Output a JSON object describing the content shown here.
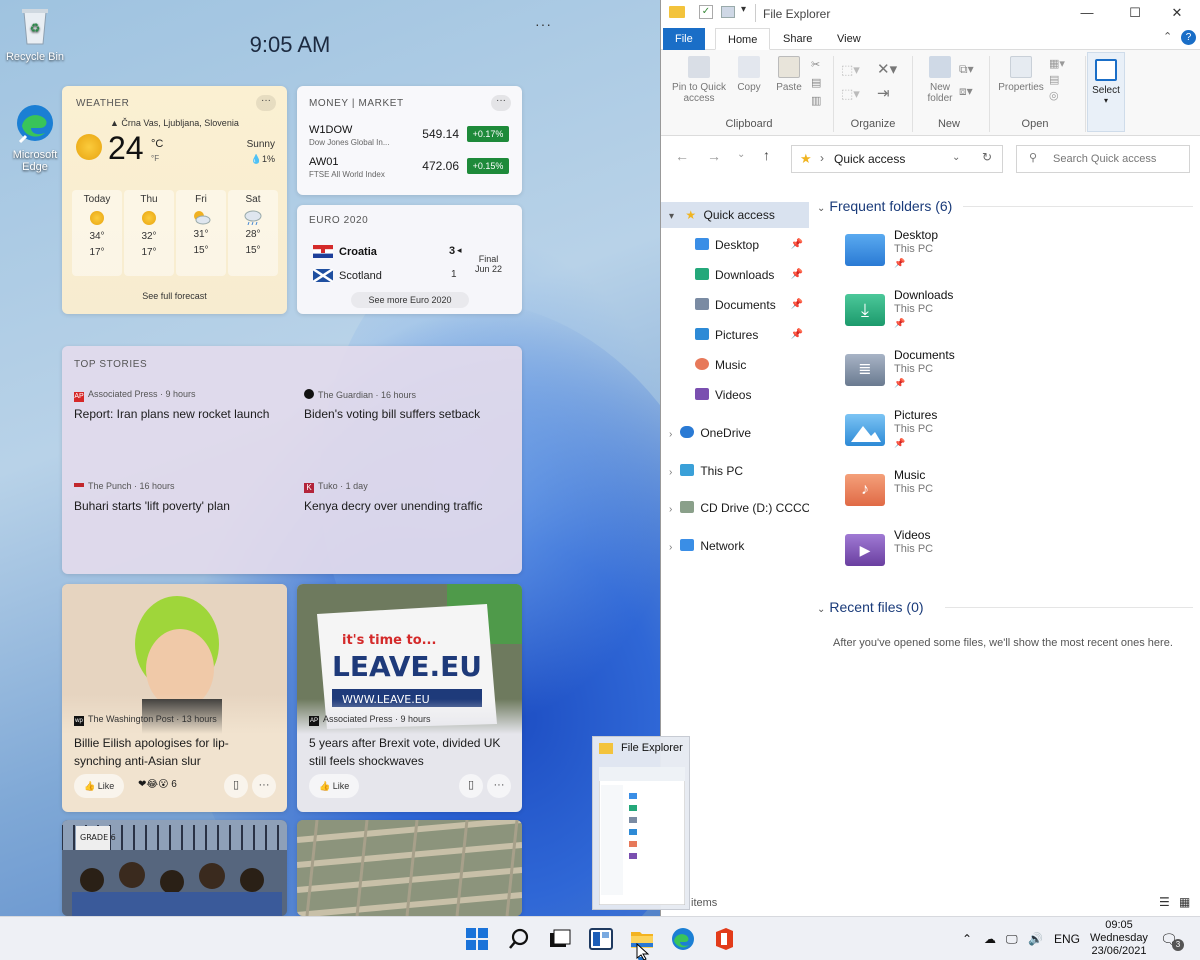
{
  "desktop": {
    "recycle_bin": "Recycle Bin",
    "edge_line1": "Microsoft",
    "edge_line2": "Edge"
  },
  "widgets": {
    "time": "9:05 AM",
    "more_glyph": "···",
    "weather": {
      "header": "WEATHER",
      "location": "Črna Vas, Ljubljana, Slovenia",
      "temp": "24",
      "unit_c": "°C",
      "unit_f": "°F",
      "condition": "Sunny",
      "precip": "1%",
      "days": [
        {
          "name": "Today",
          "high": "34°",
          "low": "17°",
          "icon": "sunny-icon"
        },
        {
          "name": "Thu",
          "high": "32°",
          "low": "17°",
          "icon": "sunny-icon"
        },
        {
          "name": "Fri",
          "high": "31°",
          "low": "15°",
          "icon": "partly-cloudy-icon"
        },
        {
          "name": "Sat",
          "high": "28°",
          "low": "15°",
          "icon": "rain-icon"
        }
      ],
      "forecast_link": "See full forecast"
    },
    "money": {
      "header": "MONEY | MARKET",
      "rows": [
        {
          "symbol": "W1DOW",
          "name": "Dow Jones Global In...",
          "value": "549.14",
          "change": "+0.17%"
        },
        {
          "symbol": "AW01",
          "name": "FTSE All World Index",
          "value": "472.06",
          "change": "+0.15%"
        }
      ]
    },
    "euro": {
      "header": "EURO 2020",
      "team1": "Croatia",
      "score1": "3",
      "team2": "Scotland",
      "score2": "1",
      "status": "Final",
      "date": "Jun 22",
      "more_link": "See more Euro 2020"
    },
    "top_stories": {
      "header": "TOP STORIES",
      "items": [
        {
          "source": "Associated Press · 9 hours",
          "title": "Report: Iran plans new rocket launch"
        },
        {
          "source": "The Guardian · 16 hours",
          "title": "Biden's voting bill suffers setback"
        },
        {
          "source": "The Punch · 16 hours",
          "title": "Buhari starts 'lift poverty' plan"
        },
        {
          "source": "Tuko · 1 day",
          "title": "Kenya decry over unending traffic"
        }
      ]
    },
    "news": [
      {
        "source": "The Washington Post · 13 hours",
        "title": "Billie Eilish apologises for lip-synching anti-Asian slur",
        "like": "Like",
        "reactions": "6"
      },
      {
        "source": "Associated Press · 9 hours",
        "title": "5 years after Brexit vote, divided UK still feels shockwaves",
        "like": "Like",
        "reactions": ""
      }
    ],
    "news_img_text": {
      "sign_top": "it's time to...",
      "sign_main": "LEAVE.EU",
      "sign_url": "WWW.LEAVE.EU",
      "sign2": "GRADE 6"
    }
  },
  "explorer": {
    "title": "File Explorer",
    "menu": {
      "file": "File",
      "home": "Home",
      "share": "Share",
      "view": "View"
    },
    "ribbon": {
      "pin": "Pin to Quick access",
      "copy": "Copy",
      "paste": "Paste",
      "clipboard": "Clipboard",
      "organize": "Organize",
      "new_folder": "New folder",
      "new": "New",
      "properties": "Properties",
      "open": "Open",
      "select": "Select"
    },
    "address": "Quick access",
    "search_placeholder": "Search Quick access",
    "nav": {
      "quick_access": "Quick access",
      "items": [
        "Desktop",
        "Downloads",
        "Documents",
        "Pictures",
        "Music",
        "Videos"
      ],
      "onedrive": "OneDrive",
      "this_pc": "This PC",
      "cd_drive": "CD Drive (D:) CCCOMA",
      "network": "Network"
    },
    "frequent_header": "Frequent folders (6)",
    "folders": [
      {
        "name": "Desktop",
        "loc": "This PC",
        "pinned": true,
        "color": "#3a8ee6"
      },
      {
        "name": "Downloads",
        "loc": "This PC",
        "pinned": true,
        "color": "#24a87a"
      },
      {
        "name": "Documents",
        "loc": "This PC",
        "pinned": true,
        "color": "#7a8ba3"
      },
      {
        "name": "Pictures",
        "loc": "This PC",
        "pinned": true,
        "color": "#2d8ad6"
      },
      {
        "name": "Music",
        "loc": "This PC",
        "pinned": false,
        "color": "#e7795a"
      },
      {
        "name": "Videos",
        "loc": "This PC",
        "pinned": false,
        "color": "#7a4fb0"
      }
    ],
    "recent_header": "Recent files (0)",
    "recent_empty": "After you've opened some files, we'll show the most recent ones here.",
    "status_items": "items"
  },
  "thumbnail": {
    "title": "File Explorer"
  },
  "taskbar": {
    "lang": "ENG",
    "time": "09:05",
    "day": "Wednesday",
    "date": "23/06/2021",
    "notif_count": "3"
  }
}
